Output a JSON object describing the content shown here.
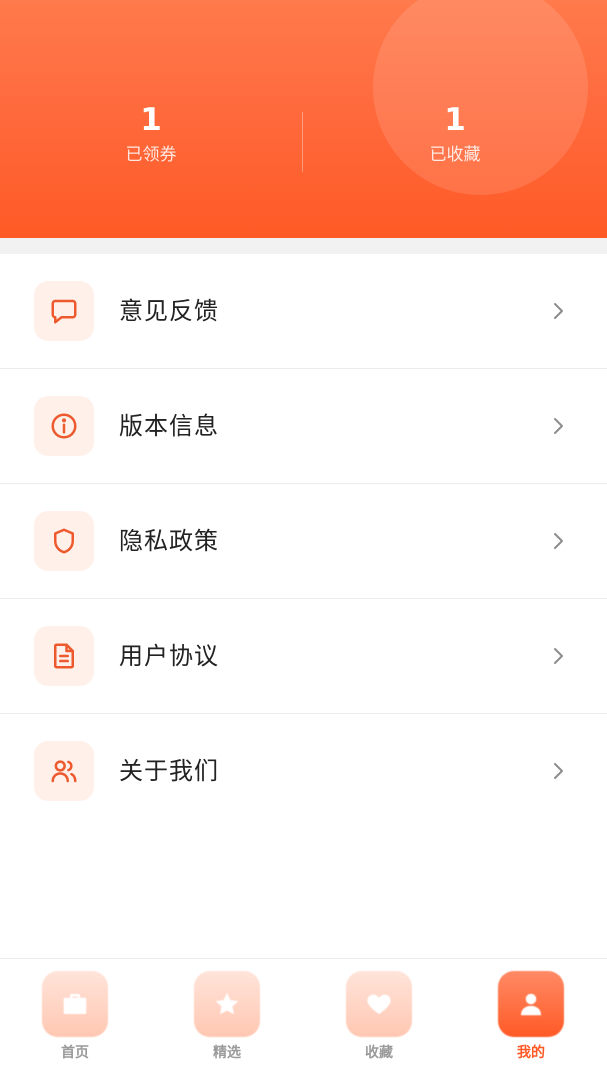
{
  "stats": {
    "coupons": {
      "value": "1",
      "label": "已领券"
    },
    "favorites": {
      "value": "1",
      "label": "已收藏"
    }
  },
  "menu": {
    "items": [
      {
        "label": "意见反馈",
        "icon": "chat-icon"
      },
      {
        "label": "版本信息",
        "icon": "info-icon"
      },
      {
        "label": "隐私政策",
        "icon": "shield-icon"
      },
      {
        "label": "用户协议",
        "icon": "document-icon"
      },
      {
        "label": "关于我们",
        "icon": "users-icon"
      }
    ]
  },
  "tabbar": {
    "tabs": [
      {
        "label": "首页",
        "icon": "briefcase-icon",
        "active": false
      },
      {
        "label": "精选",
        "icon": "star-icon",
        "active": false
      },
      {
        "label": "收藏",
        "icon": "heart-icon",
        "active": false
      },
      {
        "label": "我的",
        "icon": "user-icon",
        "active": true
      }
    ]
  },
  "colors": {
    "accent": "#ff5a26",
    "icon_bg": "#fff0ea",
    "text": "#222222",
    "muted": "#9a9a9a"
  }
}
